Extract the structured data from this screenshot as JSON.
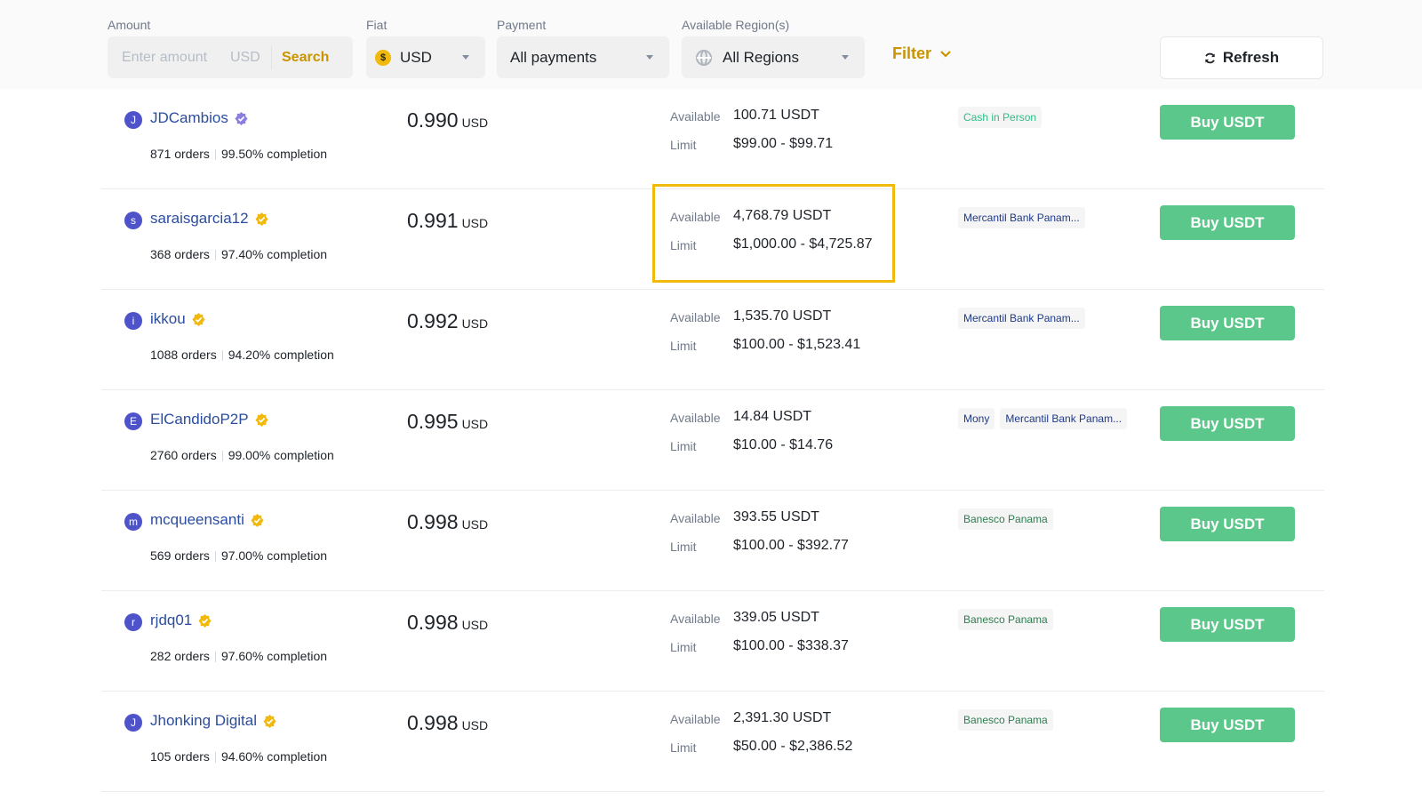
{
  "filters": {
    "amount": {
      "label": "Amount",
      "placeholder": "Enter amount",
      "unit": "USD",
      "search_label": "Search"
    },
    "fiat": {
      "label": "Fiat",
      "value": "USD",
      "icon": "dollar-coin-icon"
    },
    "payment": {
      "label": "Payment",
      "value": "All payments"
    },
    "region": {
      "label": "Available Region(s)",
      "value": "All Regions",
      "icon": "globe-icon"
    },
    "filter_label": "Filter",
    "refresh_label": "Refresh"
  },
  "colors": {
    "accent": "#c99400",
    "buy": "#5cc78a",
    "highlight": "#f0b90b",
    "link": "#2a4da0"
  },
  "ads": [
    {
      "initial": "J",
      "name": "JDCambios",
      "badge": "purple",
      "orders": "871 orders",
      "completion": "99.50% completion",
      "price": "0.990",
      "currency": "USD",
      "available_label": "Available",
      "available": "100.71 USDT",
      "limit_label": "Limit",
      "limit": "$99.00 - $99.71",
      "payments": [
        {
          "label": "Cash in Person",
          "color": "#2ebd85"
        }
      ],
      "buy_label": "Buy USDT"
    },
    {
      "initial": "s",
      "name": "saraisgarcia12",
      "badge": "gold",
      "orders": "368 orders",
      "completion": "97.40% completion",
      "price": "0.991",
      "currency": "USD",
      "available_label": "Available",
      "available": "4,768.79 USDT",
      "limit_label": "Limit",
      "limit": "$1,000.00 - $4,725.87",
      "payments": [
        {
          "label": "Mercantil Bank Panam...",
          "color": "#1e3a8a"
        }
      ],
      "buy_label": "Buy USDT"
    },
    {
      "initial": "i",
      "name": "ikkou",
      "badge": "gold",
      "orders": "1088 orders",
      "completion": "94.20% completion",
      "price": "0.992",
      "currency": "USD",
      "available_label": "Available",
      "available": "1,535.70 USDT",
      "limit_label": "Limit",
      "limit": "$100.00 - $1,523.41",
      "payments": [
        {
          "label": "Mercantil Bank Panam...",
          "color": "#1e3a8a"
        }
      ],
      "buy_label": "Buy USDT"
    },
    {
      "initial": "E",
      "name": "ElCandidoP2P",
      "badge": "gold",
      "orders": "2760 orders",
      "completion": "99.00% completion",
      "price": "0.995",
      "currency": "USD",
      "available_label": "Available",
      "available": "14.84 USDT",
      "limit_label": "Limit",
      "limit": "$10.00 - $14.76",
      "payments": [
        {
          "label": "Mony",
          "color": "#1e3a8a"
        },
        {
          "label": "Mercantil Bank Panam...",
          "color": "#1e3a8a"
        }
      ],
      "buy_label": "Buy USDT"
    },
    {
      "initial": "m",
      "name": "mcqueensanti",
      "badge": "gold",
      "orders": "569 orders",
      "completion": "97.00% completion",
      "price": "0.998",
      "currency": "USD",
      "available_label": "Available",
      "available": "393.55 USDT",
      "limit_label": "Limit",
      "limit": "$100.00 - $392.77",
      "payments": [
        {
          "label": "Banesco Panama",
          "color": "#2e7d4f"
        }
      ],
      "buy_label": "Buy USDT"
    },
    {
      "initial": "r",
      "name": "rjdq01",
      "badge": "gold",
      "orders": "282 orders",
      "completion": "97.60% completion",
      "price": "0.998",
      "currency": "USD",
      "available_label": "Available",
      "available": "339.05 USDT",
      "limit_label": "Limit",
      "limit": "$100.00 - $338.37",
      "payments": [
        {
          "label": "Banesco Panama",
          "color": "#2e7d4f"
        }
      ],
      "buy_label": "Buy USDT"
    },
    {
      "initial": "J",
      "name": "Jhonking Digital",
      "badge": "gold",
      "orders": "105 orders",
      "completion": "94.60% completion",
      "price": "0.998",
      "currency": "USD",
      "available_label": "Available",
      "available": "2,391.30 USDT",
      "limit_label": "Limit",
      "limit": "$50.00 - $2,386.52",
      "payments": [
        {
          "label": "Banesco Panama",
          "color": "#2e7d4f"
        }
      ],
      "buy_label": "Buy USDT"
    }
  ]
}
